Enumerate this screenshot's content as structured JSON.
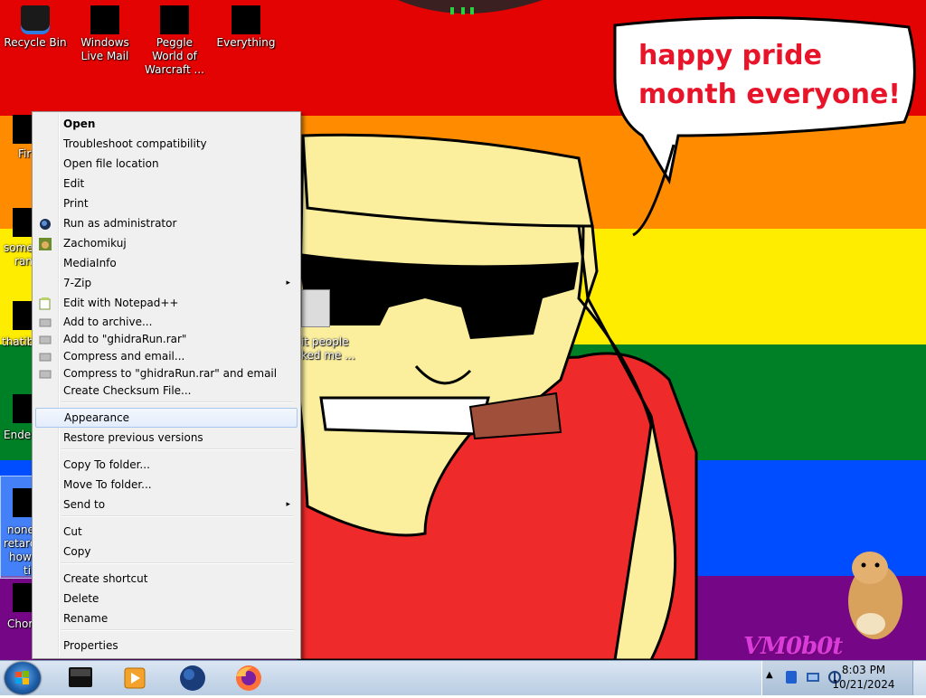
{
  "desktop": {
    "speech_bubble_text": "happy pride month everyone!",
    "watermark": "VM0b0t",
    "icons": [
      {
        "name": "recycle-bin",
        "label": "Recycle Bin"
      },
      {
        "name": "windows-live-mail",
        "label": "Windows Live Mail"
      },
      {
        "name": "peggle-world-of-warcraft",
        "label": "Peggle World of Warcraft ..."
      },
      {
        "name": "everything",
        "label": "Everything"
      }
    ],
    "partial_labels": {
      "fir": "Fir",
      "some": "some",
      "ran": "ran",
      "thatib": "thatib",
      "ender": "Ender",
      "none": "none",
      "retard": "retard",
      "how": "how",
      "ti": "ti",
      "chor": "Chor",
      "behind_menu_1": "it people",
      "behind_menu_2": "ked me ..."
    }
  },
  "context_menu": {
    "items": [
      {
        "label": "Open",
        "bold": true
      },
      {
        "label": "Troubleshoot compatibility"
      },
      {
        "label": "Open file location"
      },
      {
        "label": "Edit"
      },
      {
        "label": "Print"
      },
      {
        "label": "Run as administrator",
        "icon": "shield-globe-icon"
      },
      {
        "label": "Zachomikuj",
        "icon": "hamster-icon"
      },
      {
        "label": "MediaInfo"
      },
      {
        "label": "7-Zip",
        "submenu": true
      },
      {
        "label": "Edit with Notepad++",
        "icon": "notepad-plus-icon"
      },
      {
        "label": "Add to archive...",
        "icon": "winrar-icon"
      },
      {
        "label": "Add to \"ghidraRun.rar\"",
        "icon": "winrar-icon"
      },
      {
        "label": "Compress and email...",
        "icon": "winrar-icon"
      },
      {
        "label": "Compress to \"ghidraRun.rar\" and email",
        "icon": "winrar-icon"
      },
      {
        "label": "Create Checksum File..."
      },
      {
        "label": "Appearance",
        "hover": true
      },
      {
        "label": "Restore previous versions"
      },
      {
        "label": "Copy To folder..."
      },
      {
        "label": "Move To folder..."
      },
      {
        "label": "Send to",
        "submenu": true
      },
      {
        "label": "Cut"
      },
      {
        "label": "Copy"
      },
      {
        "label": "Create shortcut"
      },
      {
        "label": "Delete"
      },
      {
        "label": "Rename"
      },
      {
        "label": "Properties"
      }
    ],
    "submenu_arrow": "▸"
  },
  "taskbar": {
    "pinned": [
      {
        "name": "media-center-taskbar-icon"
      },
      {
        "name": "media-player-taskbar-icon"
      },
      {
        "name": "globe-taskbar-icon"
      },
      {
        "name": "firefox-taskbar-icon"
      }
    ],
    "tray_arrow": "▲",
    "time": "8:03 PM",
    "date": "10/21/2024"
  },
  "colors": {
    "pride_red": "#e40303",
    "pride_orange": "#ff8c00",
    "pride_yellow": "#ffed00",
    "pride_green": "#008026",
    "pride_blue": "#004dff",
    "pride_purple": "#750787",
    "bubble_text": "#e8152a",
    "menu_background": "#f0f0f0",
    "menu_hover": "#e3edfb"
  }
}
